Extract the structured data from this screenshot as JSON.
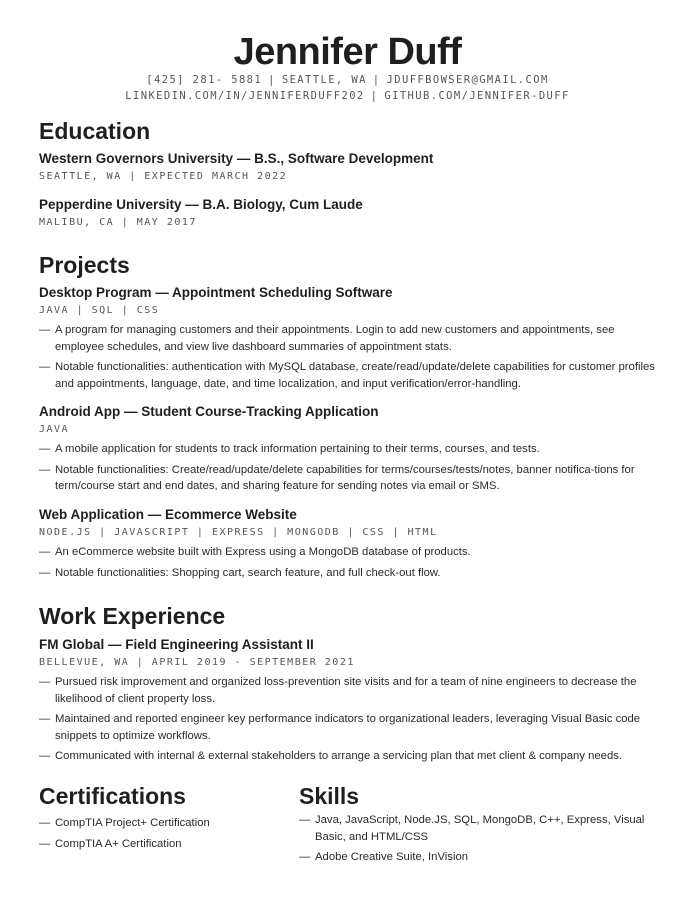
{
  "header": {
    "name": "Jennifer Duff",
    "contact_line1": [
      "[425] 281- 5881",
      "SEATTLE, WA",
      "JDUFFBOWSER@GMAIL.COM"
    ],
    "contact_line2": [
      "LINKEDIN.COM/IN/JENNIFERDUFF202",
      "GITHUB.COM/JENNIFER-DUFF"
    ],
    "separator": "|"
  },
  "education": {
    "heading": "Education",
    "entries": [
      {
        "title": "Western Governors University — B.S., Software Development",
        "meta": "SEATTLE, WA | EXPECTED MARCH 2022"
      },
      {
        "title": "Pepperdine University — B.A. Biology, Cum Laude",
        "meta": "MALIBU, CA | MAY 2017"
      }
    ]
  },
  "projects": {
    "heading": "Projects",
    "entries": [
      {
        "title": "Desktop Program — Appointment Scheduling Software",
        "meta": "JAVA | SQL | CSS",
        "bullets": [
          "A program for managing customers and their appointments. Login to add new customers and appointments, see employee schedules, and view live dashboard summaries of appointment stats.",
          "Notable functionalities: authentication with MySQL database, create/read/update/delete capabilities for customer profiles and appointments, language, date, and time localization, and input verification/error-handling."
        ]
      },
      {
        "title": "Android App — Student Course-Tracking Application",
        "meta": "JAVA",
        "bullets": [
          "A mobile application for students to track information pertaining to their terms, courses, and tests.",
          "Notable functionalities: Create/read/update/delete capabilities for terms/courses/tests/notes, banner notifica-tions for term/course start and end dates, and sharing feature for sending notes via email or SMS."
        ]
      },
      {
        "title": "Web Application — Ecommerce Website",
        "meta": "NODE.JS | JAVASCRIPT | EXPRESS | MONGODB | CSS | HTML",
        "bullets": [
          "An eCommerce website built with Express using a MongoDB database of products.",
          "Notable functionalities: Shopping cart, search feature, and full check-out flow."
        ]
      }
    ]
  },
  "work": {
    "heading": "Work Experience",
    "entries": [
      {
        "title": "FM Global — Field Engineering Assistant II",
        "meta": "BELLEVUE, WA | APRIL 2019 - SEPTEMBER 2021",
        "bullets": [
          "Pursued risk improvement and organized loss-prevention site visits and for a team of nine engineers to decrease the likelihood of client property loss.",
          "Maintained and reported engineer key performance indicators to organizational leaders, leveraging Visual Basic code snippets to optimize workflows.",
          "Communicated with internal & external stakeholders to arrange a servicing plan that met client & company needs."
        ]
      }
    ]
  },
  "certifications": {
    "heading": "Certifications",
    "items": [
      "CompTIA Project+ Certification",
      "CompTIA A+ Certification"
    ]
  },
  "skills": {
    "heading": "Skills",
    "items": [
      "Java, JavaScript, Node.JS, SQL, MongoDB, C++, Express, Visual Basic, and HTML/CSS",
      "Adobe Creative Suite, InVision"
    ]
  },
  "bullet_marker": "—"
}
